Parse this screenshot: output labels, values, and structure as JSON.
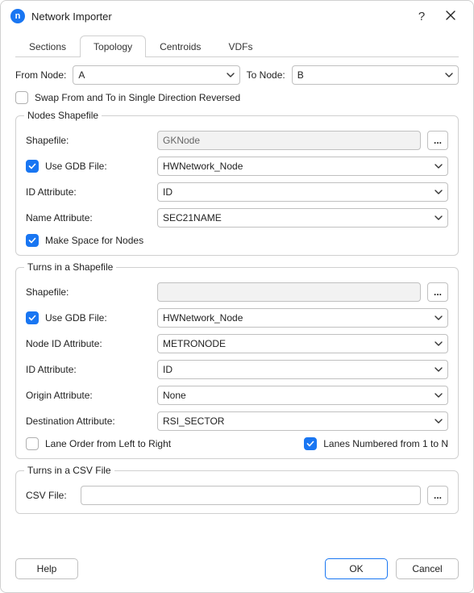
{
  "window": {
    "title": "Network Importer",
    "app_icon_letter": "n"
  },
  "tabs": [
    "Sections",
    "Topology",
    "Centroids",
    "VDFs"
  ],
  "active_tab_index": 1,
  "from_to": {
    "from_label": "From Node:",
    "from_value": "A",
    "to_label": "To Node:",
    "to_value": "B"
  },
  "swap": {
    "label": "Swap From and To in Single Direction Reversed",
    "checked": false
  },
  "nodes_group": {
    "legend": "Nodes Shapefile",
    "shapefile_label": "Shapefile:",
    "shapefile_value": "GKNode",
    "use_gdb_label": "Use GDB File:",
    "use_gdb_checked": true,
    "gdb_value": "HWNetwork_Node",
    "id_attr_label": "ID Attribute:",
    "id_attr_value": "ID",
    "name_attr_label": "Name Attribute:",
    "name_attr_value": "SEC21NAME",
    "make_space_label": "Make Space for Nodes",
    "make_space_checked": true
  },
  "turns_shp_group": {
    "legend": "Turns in a Shapefile",
    "shapefile_label": "Shapefile:",
    "shapefile_value": "",
    "use_gdb_label": "Use GDB File:",
    "use_gdb_checked": true,
    "gdb_value": "HWNetwork_Node",
    "node_id_attr_label": "Node ID Attribute:",
    "node_id_attr_value": "METRONODE",
    "id_attr_label": "ID Attribute:",
    "id_attr_value": "ID",
    "origin_attr_label": "Origin Attribute:",
    "origin_attr_value": "None",
    "dest_attr_label": "Destination Attribute:",
    "dest_attr_value": "RSI_SECTOR",
    "lane_order_label": "Lane Order from Left to Right",
    "lane_order_checked": false,
    "lanes_numbered_label": "Lanes Numbered from 1 to N",
    "lanes_numbered_checked": true
  },
  "turns_csv_group": {
    "legend": "Turns in a CSV File",
    "csv_label": "CSV File:",
    "csv_value": ""
  },
  "footer": {
    "help": "Help",
    "ok": "OK",
    "cancel": "Cancel"
  },
  "glyphs": {
    "ellipsis": "...",
    "help": "?"
  }
}
